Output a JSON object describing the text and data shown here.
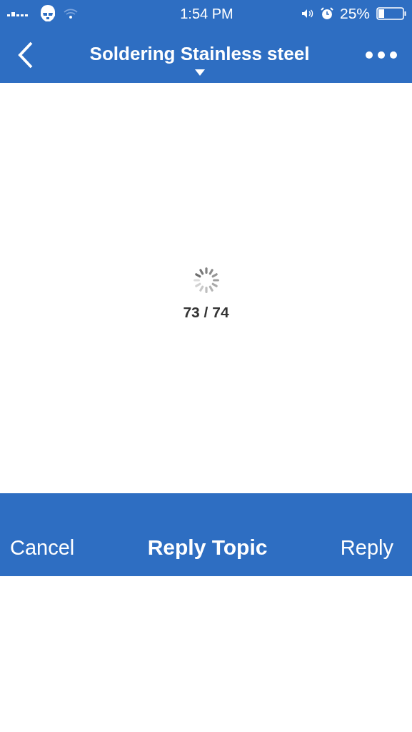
{
  "status_bar": {
    "time": "1:54 PM",
    "battery": "25%"
  },
  "nav_bar": {
    "title": "Soldering Stainless steel"
  },
  "loading": {
    "progress": "73 / 74"
  },
  "reply_bar": {
    "cancel": "Cancel",
    "title": "Reply Topic",
    "reply": "Reply"
  }
}
